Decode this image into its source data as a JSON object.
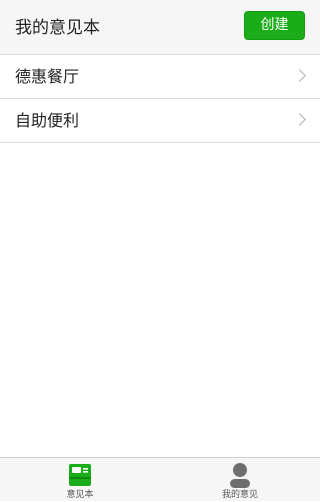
{
  "header": {
    "title": "我的意见本",
    "create_label": "创建"
  },
  "list": {
    "items": [
      {
        "label": "德惠餐厅"
      },
      {
        "label": "自助便利"
      }
    ]
  },
  "tabbar": {
    "tabs": [
      {
        "label": "意见本",
        "icon": "notebook-icon",
        "active": true,
        "color": "#1aad19"
      },
      {
        "label": "我的意见",
        "icon": "user-icon",
        "active": false,
        "color": "#6e6e6e"
      }
    ]
  },
  "colors": {
    "accent": "#1aad19",
    "header_bg": "#f6f6f6"
  }
}
